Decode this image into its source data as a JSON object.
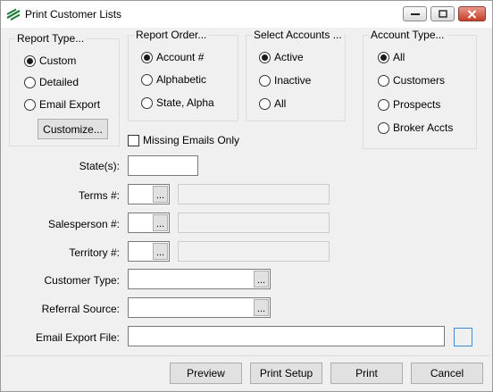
{
  "window": {
    "title": "Print Customer Lists"
  },
  "report_type": {
    "title": "Report Type...",
    "options": [
      "Custom",
      "Detailed",
      "Email Export"
    ],
    "selected": "Custom",
    "customize_label": "Customize..."
  },
  "report_order": {
    "title": "Report Order...",
    "options": [
      "Account #",
      "Alphabetic",
      "State, Alpha"
    ],
    "selected": "Account #"
  },
  "select_accounts": {
    "title": "Select Accounts ...",
    "options": [
      "Active",
      "Inactive",
      "All"
    ],
    "selected": "Active"
  },
  "account_type": {
    "title": "Account Type...",
    "options": [
      "All",
      "Customers",
      "Prospects",
      "Broker Accts"
    ],
    "selected": "All"
  },
  "missing_emails": {
    "label": "Missing Emails Only",
    "checked": false
  },
  "fields": {
    "states_label": "State(s):",
    "terms_label": "Terms #:",
    "salesperson_label": "Salesperson #:",
    "territory_label": "Territory #:",
    "customer_type_label": "Customer Type:",
    "referral_source_label": "Referral Source:",
    "email_export_label": "Email Export File:",
    "lookup_glyph": "..."
  },
  "buttons": {
    "preview": "Preview",
    "print_setup": "Print Setup",
    "print": "Print",
    "cancel": "Cancel"
  }
}
